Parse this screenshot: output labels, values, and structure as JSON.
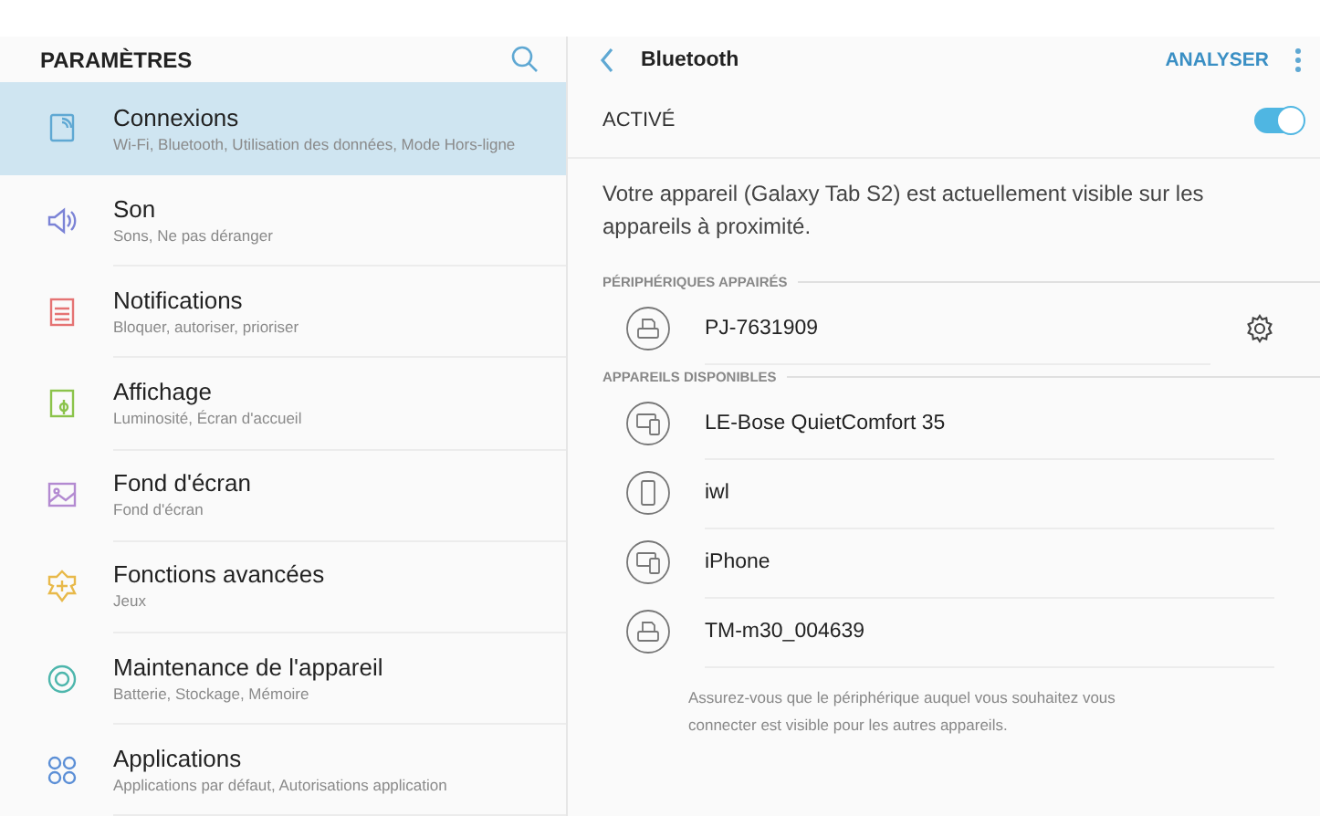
{
  "sidebar": {
    "title": "PARAMÈTRES",
    "items": [
      {
        "kind": "connections",
        "color": "#5fa8d3",
        "label": "Connexions",
        "sub": "Wi-Fi, Bluetooth, Utilisation des données, Mode Hors-ligne",
        "selected": true
      },
      {
        "kind": "sound",
        "color": "#7b83d6",
        "label": "Son",
        "sub": "Sons, Ne pas déranger",
        "selected": false
      },
      {
        "kind": "notifications",
        "color": "#e57373",
        "label": "Notifications",
        "sub": "Bloquer, autoriser, prioriser",
        "selected": false
      },
      {
        "kind": "display",
        "color": "#8bc34a",
        "label": "Affichage",
        "sub": "Luminosité, Écran d'accueil",
        "selected": false
      },
      {
        "kind": "wallpaper",
        "color": "#b38ad1",
        "label": "Fond d'écran",
        "sub": "Fond d'écran",
        "selected": false
      },
      {
        "kind": "advanced",
        "color": "#e8b94a",
        "label": "Fonctions avancées",
        "sub": "Jeux",
        "selected": false
      },
      {
        "kind": "maintenance",
        "color": "#4db6ac",
        "label": "Maintenance de l'appareil",
        "sub": "Batterie, Stockage, Mémoire",
        "selected": false
      },
      {
        "kind": "apps",
        "color": "#5c8fd6",
        "label": "Applications",
        "sub": "Applications par défaut, Autorisations application",
        "selected": false
      }
    ]
  },
  "detail": {
    "title": "Bluetooth",
    "action": "ANALYSER",
    "master": {
      "label": "ACTIVÉ",
      "on": true
    },
    "description": "Votre appareil (Galaxy Tab S2) est actuellement visible sur les appareils à proximité.",
    "sections": [
      {
        "heading": "PÉRIPHÉRIQUES APPAIRÉS",
        "devices": [
          {
            "kind": "printer",
            "name": "PJ-7631909",
            "settings": true
          }
        ]
      },
      {
        "heading": "APPAREILS DISPONIBLES",
        "devices": [
          {
            "kind": "devices",
            "name": "LE-Bose QuietComfort 35",
            "settings": false
          },
          {
            "kind": "phone",
            "name": "iwl",
            "settings": false
          },
          {
            "kind": "devices",
            "name": "iPhone",
            "settings": false
          },
          {
            "kind": "printer",
            "name": "TM-m30_004639",
            "settings": false
          }
        ]
      }
    ],
    "footnote": "Assurez-vous que le périphérique auquel vous souhaitez vous connecter est visible pour les autres appareils."
  }
}
